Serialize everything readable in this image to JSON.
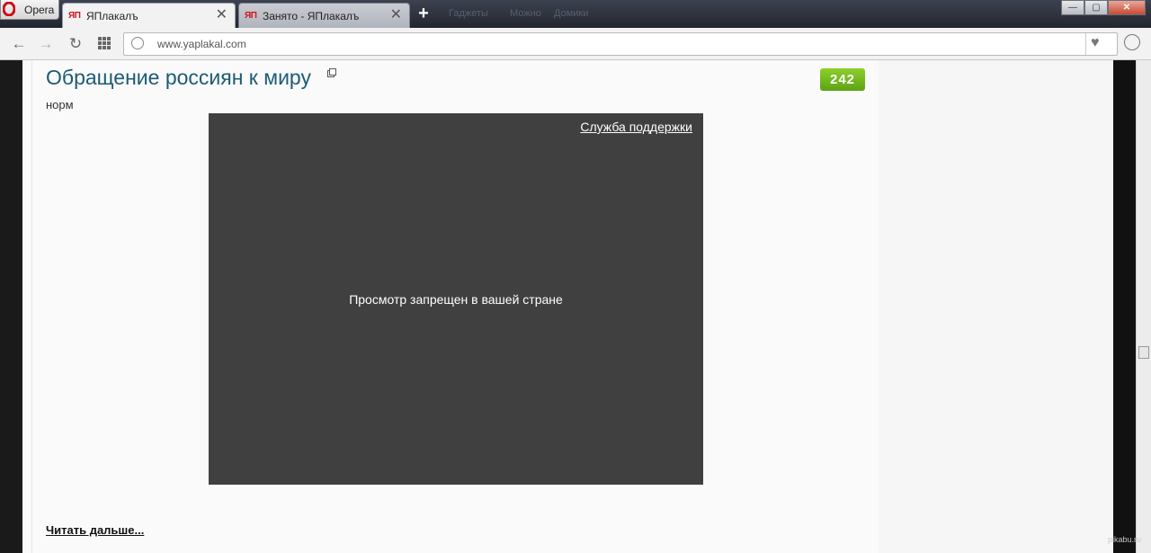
{
  "browser": {
    "menu_label": "Opera",
    "tabs": [
      {
        "favicon": "ЯП",
        "title": "ЯПлакалъ",
        "active": true
      },
      {
        "favicon": "ЯП",
        "title": "Занято - ЯПлакалъ",
        "active": false
      }
    ],
    "new_tab_symbol": "+",
    "tab_close_symbol": "✕",
    "ghost_menu": [
      "Гаджеты",
      "Можно",
      "Домики"
    ],
    "window_controls": {
      "minimize": "—",
      "maximize": "▢",
      "close": "✕"
    },
    "url": "www.yaplakal.com",
    "icons": {
      "back": "back-arrow-icon",
      "forward": "forward-arrow-icon",
      "reload": "reload-icon",
      "speed_dial": "grid-icon",
      "bookmark": "heart-icon",
      "download": "download-icon"
    }
  },
  "post": {
    "title": "Обращение россиян к миру",
    "rating": "242",
    "text": "норм",
    "video": {
      "support_link": "Служба поддержки",
      "blocked_message": "Просмотр запрещен в вашей стране"
    },
    "read_more": "Читать дальше..."
  },
  "watermark": "pikabu.ru",
  "colors": {
    "title": "#1d5b73",
    "rating_badge": "#6db31c",
    "video_bg": "#404040"
  }
}
